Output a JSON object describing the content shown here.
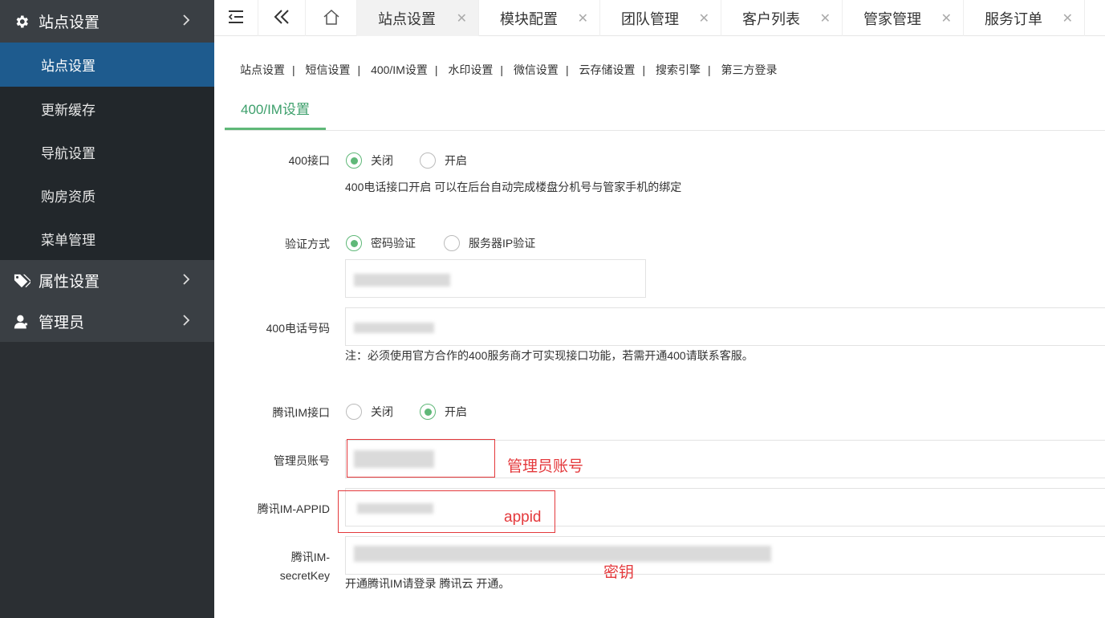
{
  "sidebar": {
    "groups": [
      {
        "label": "站点设置",
        "icon": "gear-icon"
      },
      {
        "label": "属性设置",
        "icon": "tags-icon"
      },
      {
        "label": "管理员",
        "icon": "user-icon"
      }
    ],
    "items": [
      "站点设置",
      "更新缓存",
      "导航设置",
      "购房资质",
      "菜单管理"
    ]
  },
  "tabs": [
    "站点设置",
    "模块配置",
    "团队管理",
    "客户列表",
    "管家管理",
    "服务订单"
  ],
  "sublinks": [
    "站点设置",
    "短信设置",
    "400/IM设置",
    "水印设置",
    "微信设置",
    "云存储设置",
    "搜索引擎",
    "第三方登录"
  ],
  "section_tab": "400/IM设置",
  "form": {
    "port400": {
      "label": "400接口",
      "opt_off": "关闭",
      "opt_on": "开启",
      "selected": "关闭",
      "help": "400电话接口开启 可以在后台自动完成楼盘分机号与管家手机的绑定"
    },
    "auth": {
      "label": "验证方式",
      "opt1": "密码验证",
      "opt2": "服务器IP验证",
      "selected": "密码验证"
    },
    "phone400": {
      "label": "400电话号码",
      "note": "注：必须使用官方合作的400服务商才可实现接口功能，若需开通400请联系客服。"
    },
    "im": {
      "label": "腾讯IM接口",
      "opt_off": "关闭",
      "opt_on": "开启",
      "selected": "开启"
    },
    "admin_account": {
      "label": "管理员账号"
    },
    "appid": {
      "label": "腾讯IM-APPID"
    },
    "secret": {
      "label1": "腾讯IM-",
      "label2": "secretKey",
      "help": "开通腾讯IM请登录 腾讯云 开通。"
    }
  },
  "annotations": {
    "admin_account": "管理员账号",
    "appid": "appid",
    "secret": "密钥"
  },
  "colors": {
    "sidebar_bg": "#2b2f33",
    "active_item": "#1e5b8e",
    "accent_green": "#5fb878",
    "annotation_red": "#e4393c"
  }
}
